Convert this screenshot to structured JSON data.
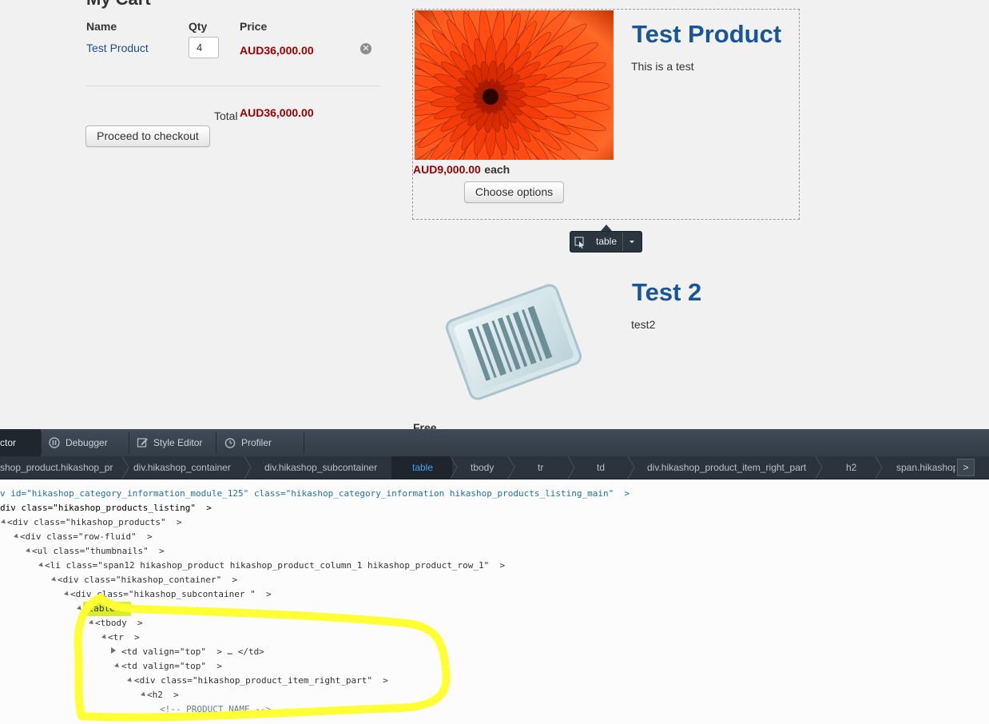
{
  "cart": {
    "title": "My Cart",
    "headers": {
      "name": "Name",
      "qty": "Qty",
      "price": "Price"
    },
    "item": {
      "name": "Test Product",
      "qty": "4",
      "price": "AUD36,000.00",
      "remove_icon": "remove-circle-icon"
    },
    "total_label": "Total",
    "total_value": "AUD36,000.00",
    "checkout_label": "Proceed to checkout"
  },
  "products": [
    {
      "title": "Test Product",
      "description": "This is a test",
      "price": "AUD9,000.00",
      "price_suffix": "each",
      "button": "Choose options",
      "image": "orange-flower-photo"
    },
    {
      "title": "Test 2",
      "description": "test2",
      "price": "Free",
      "image": "barcode-placeholder-icon"
    }
  ],
  "inspector_tooltip": {
    "label": "table",
    "picker_icon": "element-picker-icon",
    "dropdown_icon": "dropdown-arrow-icon"
  },
  "devtools": {
    "tabs": [
      "ctor",
      "Debugger",
      "Style Editor",
      "Profiler"
    ],
    "tab_icons": [
      "",
      "pause-icon",
      "pencil-icon",
      "stopwatch-icon"
    ],
    "breadcrumbs": [
      "shop_product.hikashop_pr",
      "div.hikashop_container",
      "div.hikashop_subcontainer",
      "table",
      "tbody",
      "tr",
      "td",
      "div.hikashop_product_item_right_part",
      "h2",
      "span.hikashop"
    ],
    "breadcrumb_selected": "table",
    "markup_lines": [
      "v id=\"hikashop_category_information_module_125\" class=\"hikashop_category_information hikashop_products_listing_main\"  >",
      "div class=\"hikashop_products_listing\"  >",
      "<div class=\"hikashop_products\"  >",
      "<div class=\"row-fluid\"  >",
      "<ul class=\"thumbnails\"  >",
      "<li class=\"span12 hikashop_product hikashop_product_column_1 hikashop_product_row_1\"  >",
      "<div class=\"hikashop_container\"  >",
      "<div class=\"hikashop_subcontainer \"  >",
      "<table  >",
      "<tbody  >",
      "<tr  >",
      "<td valign=\"top\"  > … </td>",
      "<td valign=\"top\"  >",
      "<div class=\"hikashop_product_item_right_part\"  >",
      "<h2  >",
      "<!-- PRODUCT NAME -->"
    ]
  },
  "colors": {
    "link": "#1a4f8b",
    "price_red": "#9a0000",
    "product_title": "#1a5594",
    "highlight": "#ffff33",
    "selected_crumb": "#43a3f0"
  }
}
